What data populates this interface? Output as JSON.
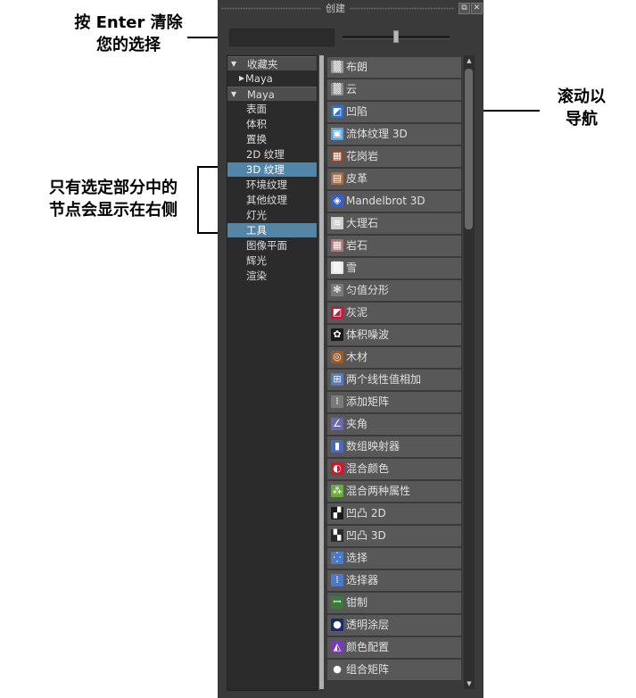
{
  "panel": {
    "title": "创建",
    "float_label": "⧉",
    "close_label": "✕"
  },
  "search": {
    "value": "",
    "placeholder": ""
  },
  "slider": {
    "value": 0.5
  },
  "tree": {
    "items": [
      {
        "label": "收藏夹",
        "type": "header",
        "arrow": "▼"
      },
      {
        "label": "Maya",
        "type": "sub",
        "arrow": "▶"
      },
      {
        "label": "Maya",
        "type": "header",
        "arrow": "▼"
      },
      {
        "label": "表面",
        "type": "item"
      },
      {
        "label": "体积",
        "type": "item"
      },
      {
        "label": "置换",
        "type": "item"
      },
      {
        "label": "2D 纹理",
        "type": "item"
      },
      {
        "label": "3D 纹理",
        "type": "item",
        "selected": true
      },
      {
        "label": "环境纹理",
        "type": "item"
      },
      {
        "label": "其他纹理",
        "type": "item"
      },
      {
        "label": "灯光",
        "type": "item"
      },
      {
        "label": "工具",
        "type": "item",
        "selected": true
      },
      {
        "label": "图像平面",
        "type": "item"
      },
      {
        "label": "辉光",
        "type": "item"
      },
      {
        "label": "渲染",
        "type": "item"
      }
    ]
  },
  "nodes": {
    "items": [
      {
        "label": "布朗",
        "icon": "brownian-icon",
        "color": "#9a9a9a",
        "glyph": "▒"
      },
      {
        "label": "云",
        "icon": "cloud-icon",
        "color": "#8c8c8c",
        "glyph": "▒"
      },
      {
        "label": "凹陷",
        "icon": "crater-icon",
        "color": "#2f6fd0",
        "glyph": "◩"
      },
      {
        "label": "流体纹理 3D",
        "icon": "fluid-texture-icon",
        "color": "#5aa3e0",
        "glyph": "▣"
      },
      {
        "label": "花岗岩",
        "icon": "granite-icon",
        "color": "#8a4a30",
        "glyph": "▦"
      },
      {
        "label": "皮革",
        "icon": "leather-icon",
        "color": "#a86a3a",
        "glyph": "▤"
      },
      {
        "label": "Mandelbrot 3D",
        "icon": "mandelbrot-icon",
        "color": "#3a5ec8",
        "glyph": "◈"
      },
      {
        "label": "大理石",
        "icon": "marble-icon",
        "color": "#cfcfcf",
        "glyph": "≋"
      },
      {
        "label": "岩石",
        "icon": "rock-icon",
        "color": "#a87a7a",
        "glyph": "▦"
      },
      {
        "label": "雪",
        "icon": "snow-icon",
        "color": "#e8e8e8",
        "glyph": "▒"
      },
      {
        "label": "匀值分形",
        "icon": "solid-fractal-icon",
        "color": "#7a7a7a",
        "glyph": "✻"
      },
      {
        "label": "灰泥",
        "icon": "stucco-icon",
        "color": "#c01a3a",
        "glyph": "◩"
      },
      {
        "label": "体积噪波",
        "icon": "volume-noise-icon",
        "color": "#1a1a1a",
        "glyph": "✿"
      },
      {
        "label": "木材",
        "icon": "wood-icon",
        "color": "#9a5a2a",
        "glyph": "◎"
      },
      {
        "label": "两个线性值相加",
        "icon": "add-double-linear-icon",
        "color": "#5a7ab8",
        "glyph": "⊞"
      },
      {
        "label": "添加矩阵",
        "icon": "add-matrix-icon",
        "color": "#7a7a7a",
        "glyph": "⁞"
      },
      {
        "label": "夹角",
        "icon": "angle-between-icon",
        "color": "#6a6aa8",
        "glyph": "∠"
      },
      {
        "label": "数组映射器",
        "icon": "array-mapper-icon",
        "color": "#4a6ab8",
        "glyph": "▮"
      },
      {
        "label": "混合颜色",
        "icon": "blend-colors-icon",
        "color": "#c81a2a",
        "glyph": "◐"
      },
      {
        "label": "混合两种属性",
        "icon": "blend-two-attr-icon",
        "color": "#6aaa3a",
        "glyph": "⁂"
      },
      {
        "label": "凹凸 2D",
        "icon": "bump-2d-icon",
        "color": "#1a1a1a",
        "glyph": "▞"
      },
      {
        "label": "凹凸 3D",
        "icon": "bump-3d-icon",
        "color": "#2a2a2a",
        "glyph": "▚"
      },
      {
        "label": "选择",
        "icon": "choice-icon",
        "color": "#4a7ac8",
        "glyph": "⁛"
      },
      {
        "label": "选择器",
        "icon": "chooser-icon",
        "color": "#4a7ac8",
        "glyph": "⁞"
      },
      {
        "label": "钳制",
        "icon": "clamp-icon",
        "color": "#3a7a3a",
        "glyph": "ꟷ"
      },
      {
        "label": "透明涂层",
        "icon": "clear-coat-icon",
        "color": "#1a2a6a",
        "glyph": "●"
      },
      {
        "label": "颜色配置",
        "icon": "color-profile-icon",
        "color": "#7a3ab8",
        "glyph": "◭"
      },
      {
        "label": "组合矩阵",
        "icon": "compose-matrix-icon",
        "color": "#5a5a5a",
        "glyph": "●"
      }
    ]
  },
  "annotations": {
    "search_note_line1": "按 Enter 清除",
    "search_note_line2": "您的选择",
    "filter_note_line1": "只有选定部分中的",
    "filter_note_line2": "节点会显示在右侧",
    "scroll_note_line1": "滚动以",
    "scroll_note_line2": "导航"
  }
}
